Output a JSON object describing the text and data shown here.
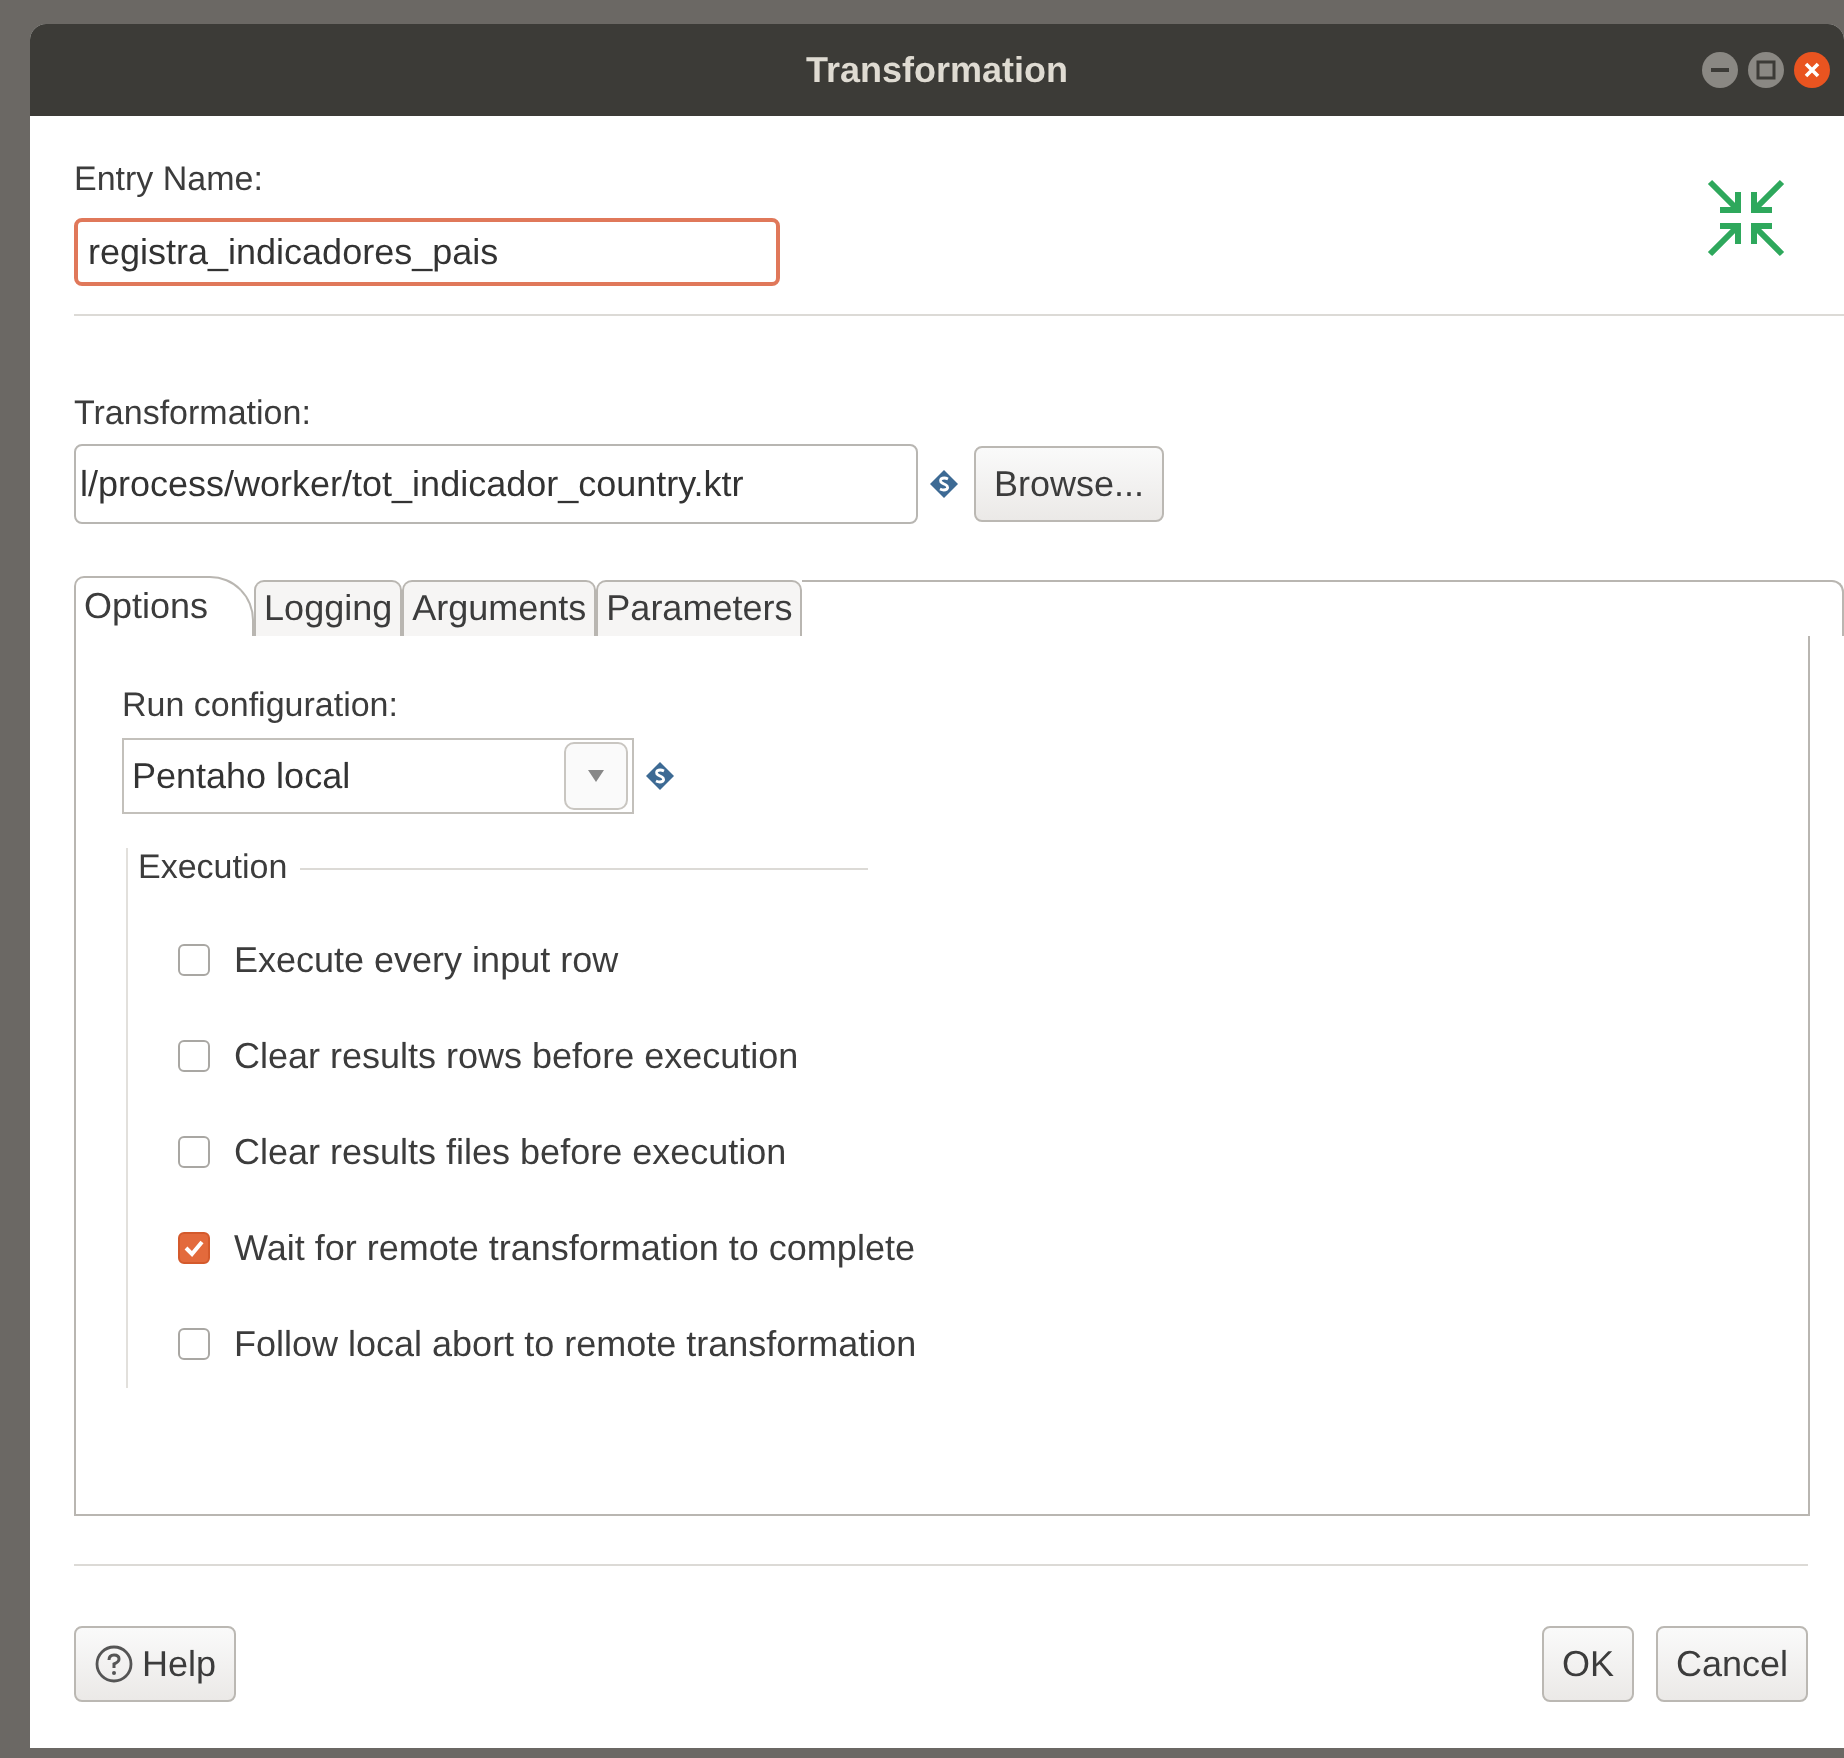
{
  "window": {
    "title": "Transformation"
  },
  "entry_name": {
    "label": "Entry Name:",
    "value": "registra_indicadores_pais",
    "focused": true
  },
  "transformation": {
    "label": "Transformation:",
    "value": "l/process/worker/tot_indicador_country.ktr",
    "browse_button": "Browse..."
  },
  "tabs": [
    {
      "label": "Options",
      "selected": true
    },
    {
      "label": "Logging",
      "selected": false
    },
    {
      "label": "Arguments",
      "selected": false
    },
    {
      "label": "Parameters",
      "selected": false
    }
  ],
  "run_configuration": {
    "label": "Run configuration:",
    "value": "Pentaho local"
  },
  "execution": {
    "title": "Execution",
    "options": [
      {
        "label": "Execute every input row",
        "checked": false
      },
      {
        "label": "Clear results rows before execution",
        "checked": false
      },
      {
        "label": "Clear results files before execution",
        "checked": false
      },
      {
        "label": "Wait for remote transformation to complete",
        "checked": true
      },
      {
        "label": "Follow local abort to remote transformation",
        "checked": false
      }
    ]
  },
  "buttons": {
    "help": "Help",
    "ok": "OK",
    "cancel": "Cancel"
  }
}
